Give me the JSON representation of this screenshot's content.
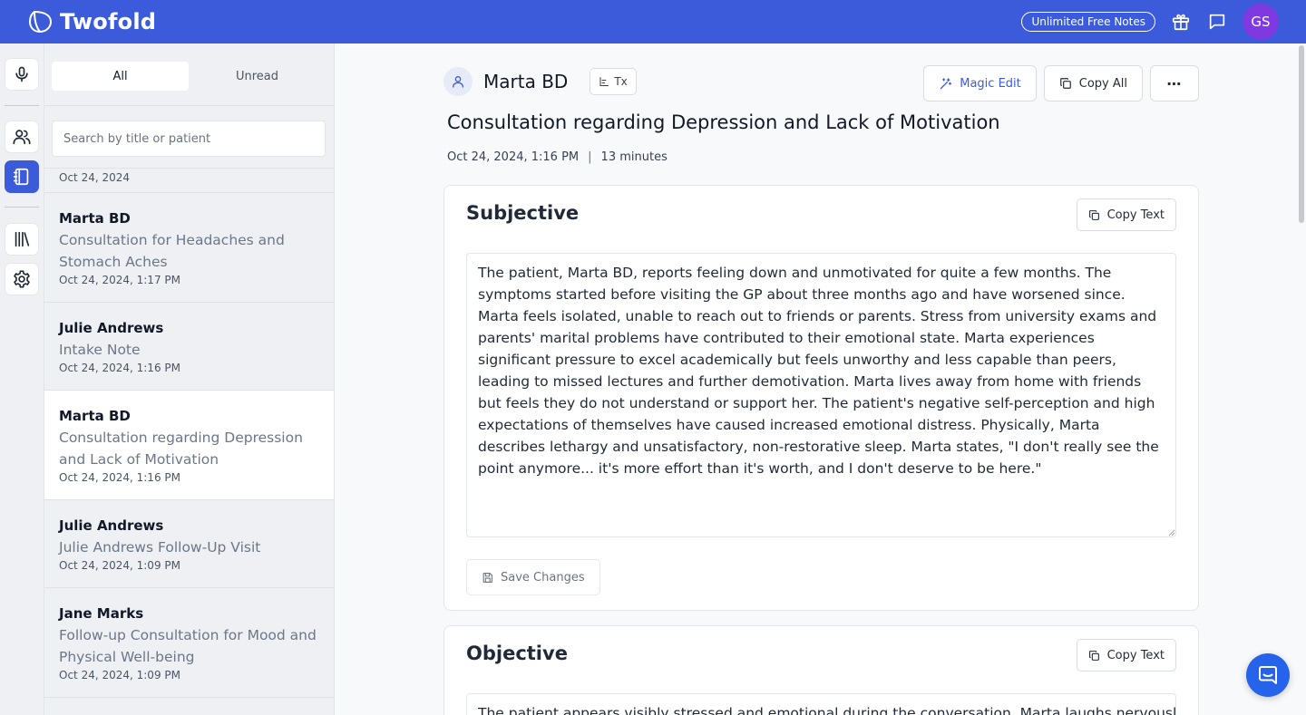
{
  "app": {
    "name": "Twofold",
    "promo_label": "Unlimited Free Notes",
    "user_initials": "GS",
    "brand_color": "#3b5bdb",
    "avatar_color": "#7e3ae0"
  },
  "rail": {
    "items": [
      {
        "icon": "microphone-icon",
        "active": false
      },
      {
        "icon": "users-icon",
        "active": false
      },
      {
        "icon": "notebook-icon",
        "active": true
      },
      {
        "icon": "library-icon",
        "active": false
      },
      {
        "icon": "gear-icon",
        "active": false
      }
    ]
  },
  "list": {
    "tabs": [
      {
        "label": "All",
        "active": true
      },
      {
        "label": "Unread",
        "active": false
      }
    ],
    "search_placeholder": "Search by title or patient",
    "date_group": "Oct 24, 2024",
    "notes": [
      {
        "patient": "Marta BD",
        "title": "Consultation for Headaches and Stomach Aches",
        "date": "Oct 24, 2024, 1:17 PM",
        "selected": false
      },
      {
        "patient": "Julie Andrews",
        "title": "Intake Note",
        "date": "Oct 24, 2024, 1:16 PM",
        "selected": false
      },
      {
        "patient": "Marta BD",
        "title": "Consultation regarding Depression and Lack of Motivation",
        "date": "Oct 24, 2024, 1:16 PM",
        "selected": true
      },
      {
        "patient": "Julie Andrews",
        "title": "Julie Andrews Follow-Up Visit",
        "date": "Oct 24, 2024, 1:09 PM",
        "selected": false
      },
      {
        "patient": "Jane Marks",
        "title": "Follow-up Consultation for Mood and Physical Well-being",
        "date": "Oct 24, 2024, 1:09 PM",
        "selected": false
      }
    ]
  },
  "note": {
    "patient": "Marta BD",
    "tx_label": "Tx",
    "actions": {
      "magic_edit": "Magic Edit",
      "copy_all": "Copy All",
      "more": "⋯"
    },
    "title": "Consultation regarding Depression and Lack of Motivation",
    "datetime": "Oct 24, 2024, 1:16 PM",
    "separator": "|",
    "duration": "13 minutes",
    "sections": [
      {
        "heading": "Subjective",
        "copy_label": "Copy Text",
        "text": "The patient, Marta BD, reports feeling down and unmotivated for quite a few months. The symptoms started before visiting the GP about three months ago and have worsened since. Marta feels isolated, unable to reach out to friends or parents. Stress from university exams and parents' marital problems have contributed to their emotional state. Marta experiences significant pressure to excel academically but feels unworthy and less capable than peers, leading to missed lectures and further demotivation. Marta lives away from home with friends but feels they do not understand or support her. The patient's negative self-perception and high expectations of themselves have caused increased emotional distress. Physically, Marta describes lethargy and unsatisfactory, non-restorative sleep. Marta states, \"I don't really see the point anymore... it's more effort than it's worth, and I don't deserve to be here.\"",
        "save_label": "Save Changes"
      },
      {
        "heading": "Objective",
        "copy_label": "Copy Text",
        "text": "The patient appears visibly stressed and emotional during the conversation. Marta laughs nervously"
      }
    ]
  }
}
